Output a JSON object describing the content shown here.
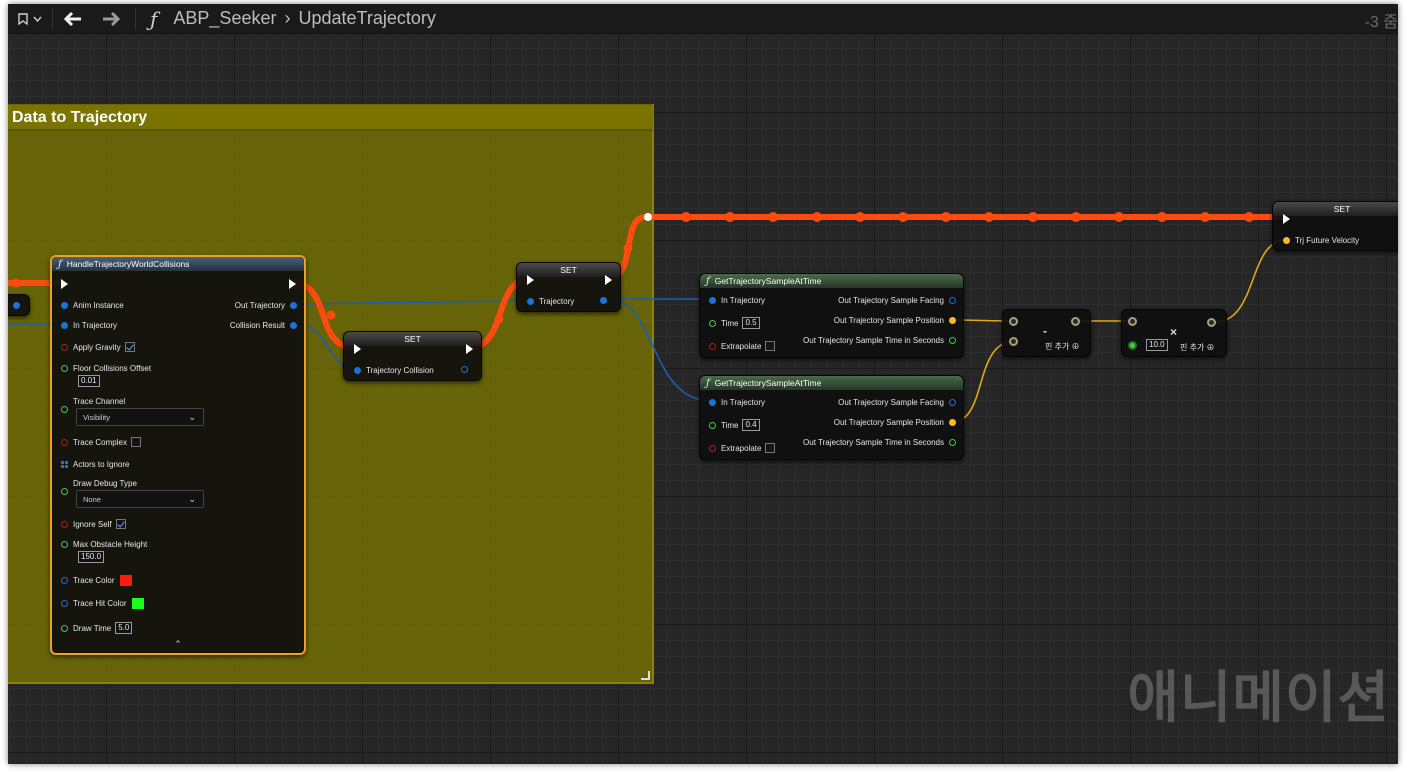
{
  "breadcrumb": {
    "blueprint": "ABP_Seeker",
    "function": "UpdateTrajectory"
  },
  "zoom_label": "-3 줌",
  "comment": {
    "title": "Data to Trajectory"
  },
  "watermark": "애니메이션",
  "colors": {
    "exec_wire": "#ff4a10",
    "struct_wire": "#1a5fb4",
    "vector_wire": "#e0a81a",
    "comment": "#7b7300"
  },
  "handle_node": {
    "title": "HandleTrajectoryWorldCollisions",
    "anim_instance": "Anim Instance",
    "in_trajectory": "In Trajectory",
    "apply_gravity": "Apply Gravity",
    "floor_offset_label": "Floor Collisions Offset",
    "floor_offset_value": "0.01",
    "trace_channel_label": "Trace Channel",
    "trace_channel_value": "Visibility",
    "trace_complex": "Trace Complex",
    "actors_to_ignore": "Actors to Ignore",
    "draw_debug_label": "Draw Debug Type",
    "draw_debug_value": "None",
    "ignore_self": "Ignore Self",
    "max_obstacle_label": "Max Obstacle Height",
    "max_obstacle_value": "150.0",
    "trace_color": "Trace Color",
    "trace_hit_color": "Trace Hit Color",
    "draw_time": "Draw Time",
    "draw_time_value": "5.0",
    "out_trajectory": "Out Trajectory",
    "collision_result": "Collision Result"
  },
  "set_collision": {
    "title": "SET",
    "pin": "Trajectory Collision"
  },
  "set_trajectory": {
    "title": "SET",
    "pin": "Trajectory"
  },
  "sample_top": {
    "title": "GetTrajectorySampleAtTime",
    "in_trajectory": "In Trajectory",
    "time": "Time",
    "time_value": "0.5",
    "extrapolate": "Extrapolate",
    "out_facing": "Out Trajectory Sample Facing",
    "out_position": "Out Trajectory Sample Position",
    "out_time": "Out Trajectory Sample Time in Seconds"
  },
  "sample_bottom": {
    "title": "GetTrajectorySampleAtTime",
    "in_trajectory": "In Trajectory",
    "time": "Time",
    "time_value": "0.4",
    "extrapolate": "Extrapolate",
    "out_facing": "Out Trajectory Sample Facing",
    "out_position": "Out Trajectory Sample Position",
    "out_time": "Out Trajectory Sample Time in Seconds"
  },
  "subtract_node": {
    "symbol": "-",
    "add_pin": "핀 추가"
  },
  "multiply_node": {
    "symbol": "×",
    "value": "10.0",
    "add_pin": "핀 추가"
  },
  "set_velocity": {
    "title": "SET",
    "pin": "Trj Future Velocity"
  }
}
